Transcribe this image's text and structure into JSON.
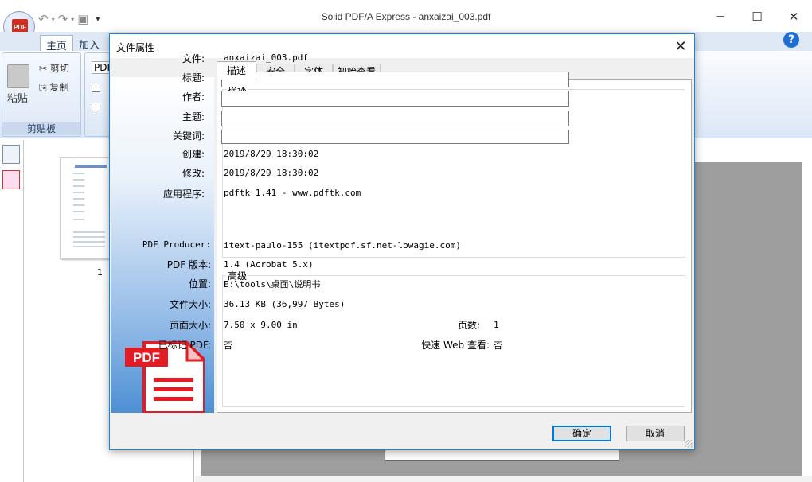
{
  "app": {
    "title": "Solid PDF/A Express - anxaizai_003.pdf",
    "logo_text": "PDF",
    "tabs": [
      "主页",
      "加入"
    ],
    "help_glyph": "?",
    "clipboard": {
      "paste": "粘贴",
      "cut": "剪切",
      "copy": "复制",
      "group_label": "剪贴板"
    },
    "pdf_group_text": "PDF",
    "thumbnail_page_number": "1"
  },
  "dialog": {
    "title": "文件属性",
    "tabs": [
      "描述",
      "安全",
      "字体",
      "初始查看"
    ],
    "active_tab": "描述",
    "description": {
      "legend": "描述",
      "fields": [
        {
          "label": "文件:",
          "value": "anxaizai_003.pdf"
        },
        {
          "label": "标题:",
          "value": ""
        },
        {
          "label": "作者:",
          "value": ""
        },
        {
          "label": "主题:",
          "value": ""
        },
        {
          "label": "关键词:",
          "value": ""
        },
        {
          "label": "创建:",
          "value": "2019/8/29 18:30:02"
        },
        {
          "label": "修改:",
          "value": "2019/8/29 18:30:02"
        },
        {
          "label": "应用程序:",
          "value": "pdftk 1.41 - www.pdftk.com"
        }
      ]
    },
    "advanced": {
      "legend": "高级",
      "producer_label": "PDF Producer:",
      "producer_value": "itext-paulo-155 (itextpdf.sf.net-lowagie.com)",
      "version_label": "PDF 版本:",
      "version_value": "1.4 (Acrobat 5.x)",
      "location_label": "位置:",
      "location_value": "E:\\tools\\桌面\\说明书",
      "size_label": "文件大小:",
      "size_value": "36.13 KB (36,997 Bytes)",
      "page_size_label": "页面大小:",
      "page_size_value": "7.50 x 9.00 in",
      "pages_label": "页数:",
      "pages_value": "1",
      "tagged_label": "已标记 PDF:",
      "tagged_value": "否",
      "fastweb_label": "快速 Web 查看:",
      "fastweb_value": "否"
    },
    "badge_text": "PDF",
    "buttons": {
      "ok": "确定",
      "cancel": "取消"
    }
  },
  "colors": {
    "accent": "#0078d7",
    "pdf_red": "#e31b23",
    "ribbon_bg": "#dfe9f5"
  }
}
